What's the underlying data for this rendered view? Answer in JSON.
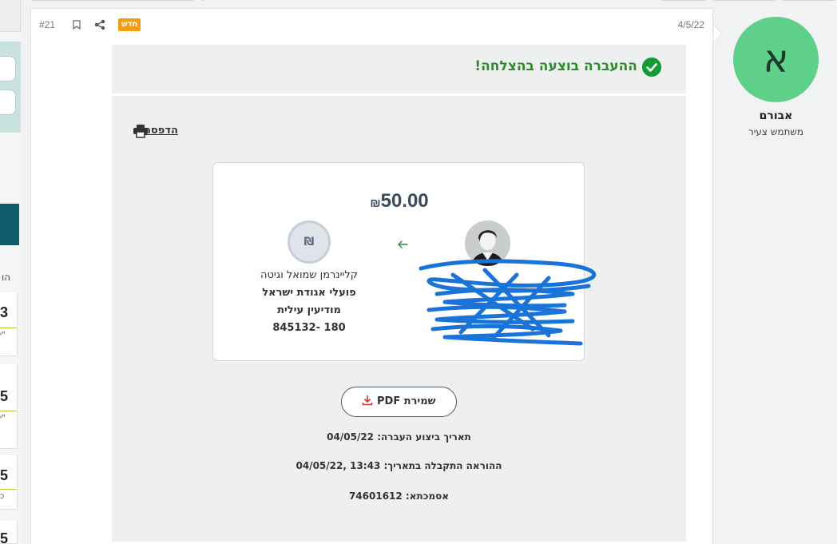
{
  "post": {
    "number": "#21",
    "date": "4/5/22",
    "new_badge": "חדש"
  },
  "transfer": {
    "success_message": "ההעברה בוצעה בהצלחה!",
    "print_label": "הדפסה",
    "amount": "50.00",
    "currency": "₪",
    "recipient": {
      "name": "קליינרמן שמואל וגיטה",
      "bank": "פועלי אגודת ישראל",
      "branch": "מודיעין עילית",
      "account": "180 -845132"
    },
    "save_pdf_label": "שמירת PDF",
    "execution_date": "תאריך ביצוע העברה: 04/05/22",
    "received_date": "ההוראה התקבלה בתאריך: 13:43 ,04/05/22",
    "reference": "אסמכתא: 74601612"
  },
  "user": {
    "initial": "א",
    "name": "אבורם",
    "role": "משתמש צעיר"
  },
  "left_sidebar": {
    "letter": "הו",
    "cards": [
      {
        "num": "3",
        "sub": "י\""
      },
      {
        "num": "5",
        "sub": "י\""
      },
      {
        "num": "5",
        "sub": "כ"
      },
      {
        "num": "5",
        "sub": ""
      }
    ]
  },
  "colors": {
    "success_green": "#159a38",
    "avatar_green": "#5fd08a",
    "badge_orange": "#f39c12",
    "pdf_icon_red": "#d9342b"
  }
}
